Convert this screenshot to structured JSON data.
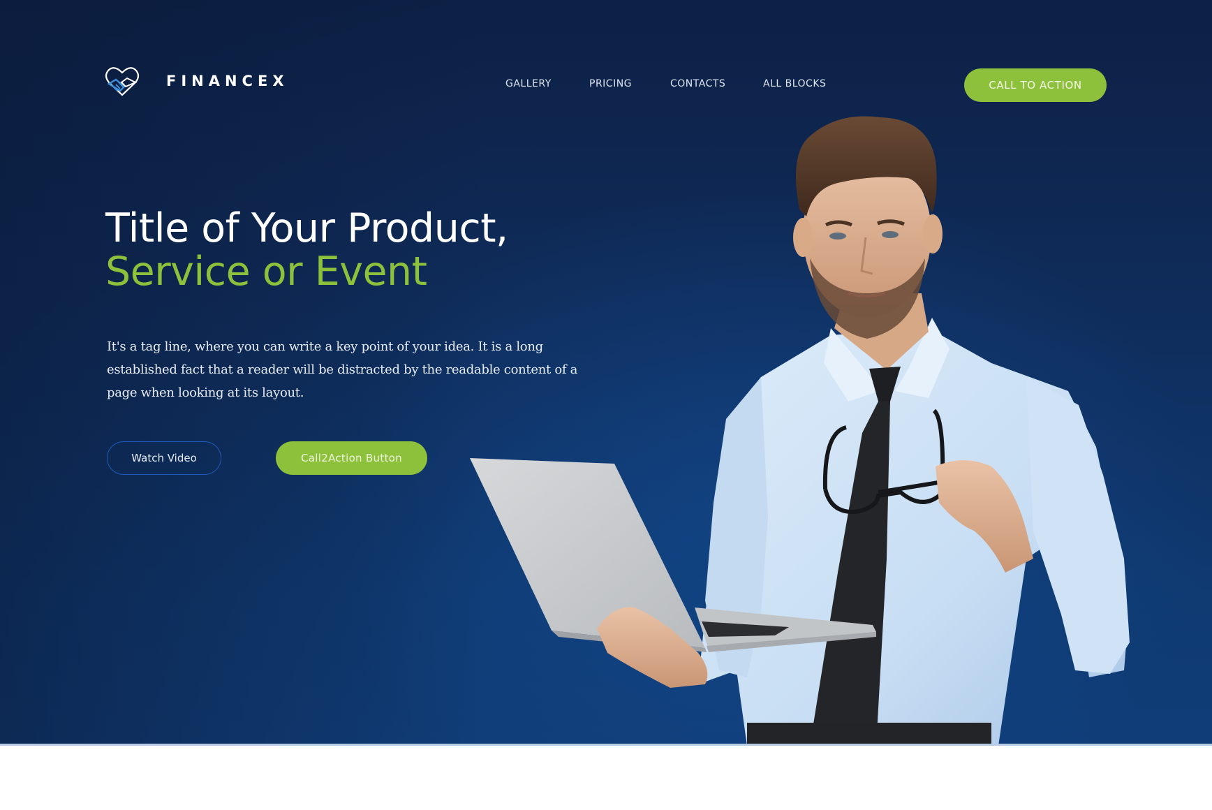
{
  "brand": {
    "name": "FINANCEX",
    "logo_icon": "handshake-heart-icon",
    "accent_color": "#8dc13c",
    "logo_blue": "#3d8fd9"
  },
  "nav": {
    "items": [
      {
        "label": "GALLERY"
      },
      {
        "label": "PRICING"
      },
      {
        "label": "CONTACTS"
      },
      {
        "label": "ALL BLOCKS"
      }
    ],
    "cta_label": "CALL TO ACTION"
  },
  "hero": {
    "title_line1": "Title of Your Product,",
    "title_line2": "Service or Event",
    "tagline": "It's a tag line, where you can write a key point of your idea. It is a long established fact that a reader will be distracted by the readable content of a page when looking at its layout.",
    "buttons": {
      "secondary_label": "Watch Video",
      "primary_label": "Call2Action Button"
    },
    "image": "businessman-holding-laptop-and-glasses"
  },
  "colors": {
    "background_top": "#0d2045",
    "background_bottom": "#103d78",
    "title_white": "#ffffff",
    "title_green": "#8dc13c",
    "outline_button_border": "#1f5cb8"
  }
}
